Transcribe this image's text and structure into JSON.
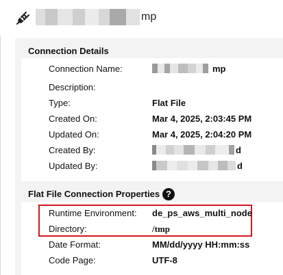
{
  "header": {
    "icon": "plug-icon",
    "title_visible_suffix": "mp"
  },
  "connection_details": {
    "section_title": "Connection Details",
    "rows": [
      {
        "label": "Connection Name:",
        "value": "mp"
      },
      {
        "label": "Description:",
        "value": ""
      },
      {
        "label": "Type:",
        "value": "Flat File"
      },
      {
        "label": "Created On:",
        "value": "Mar 4, 2025, 2:03:45 PM"
      },
      {
        "label": "Updated On:",
        "value": "Mar 4, 2025, 2:04:20 PM"
      },
      {
        "label": "Created By:",
        "value": "d"
      },
      {
        "label": "Updated By:",
        "value": "d"
      }
    ]
  },
  "flat_file_properties": {
    "section_title": "Flat File Connection Properties",
    "help_icon": "?",
    "rows": [
      {
        "label": "Runtime Environment:",
        "value": "de_ps_aws_multi_node"
      },
      {
        "label": "Directory:",
        "value": "/tmp"
      },
      {
        "label": "Date Format:",
        "value": "MM/dd/yyyy HH:mm:ss"
      },
      {
        "label": "Code Page:",
        "value": "UTF-8"
      }
    ]
  },
  "colors": {
    "highlight_border": "#d0181e",
    "panel_bg": "#f3f3f3"
  }
}
